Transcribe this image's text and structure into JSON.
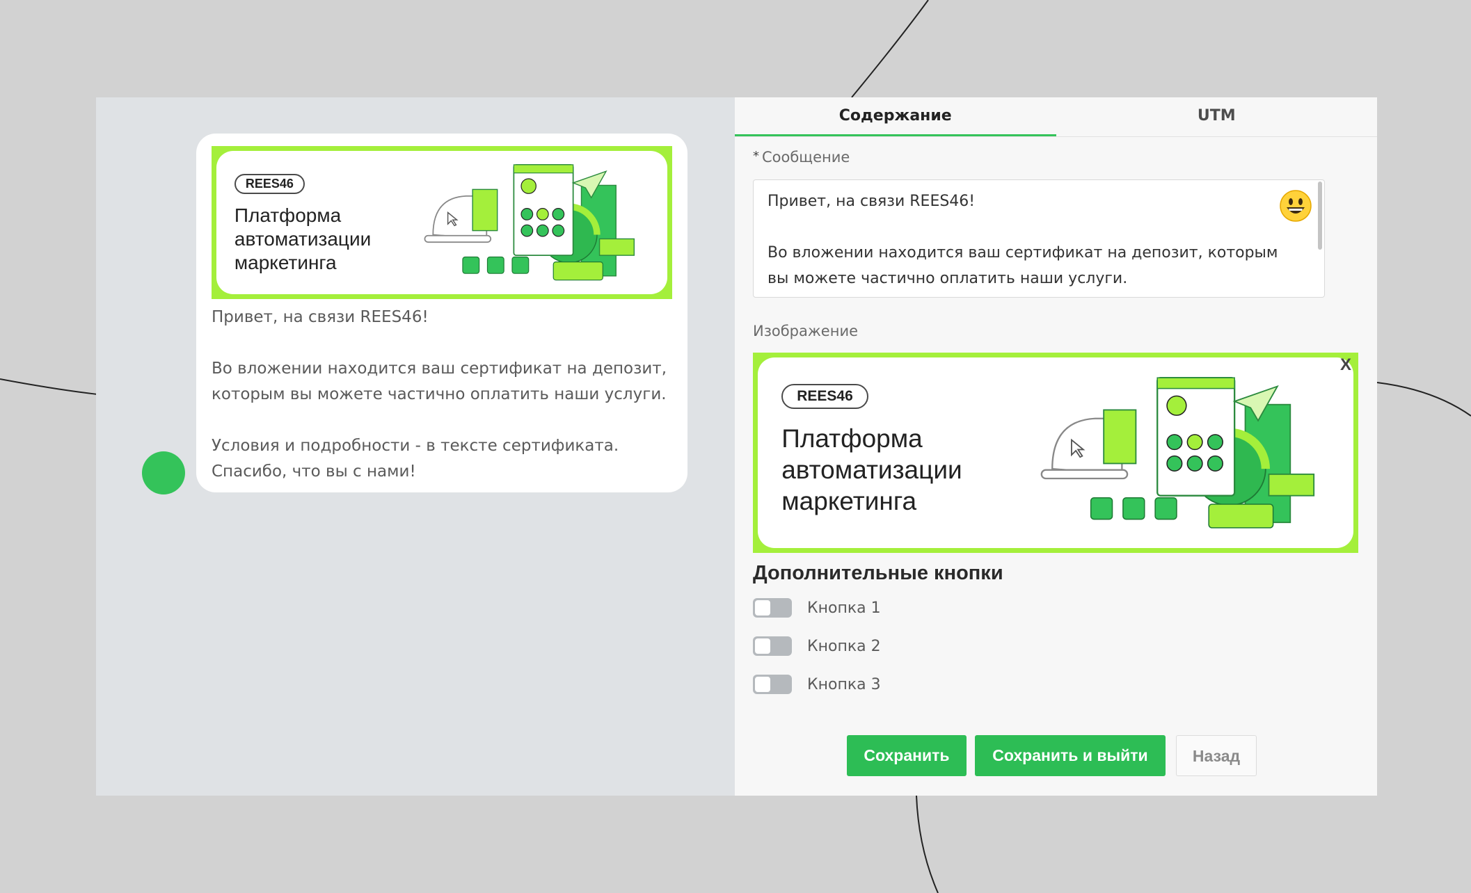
{
  "preview": {
    "banner": {
      "tag": "REES46",
      "headline": "Платформа\nавтоматизации\nмаркетинга"
    },
    "message": "Привет, на связи REES46!\n\nВо вложении находится ваш сертификат на депозит,\nкоторым вы можете частично оплатить наши услуги.\n\nУсловия и подробности - в тексте сертификата.\nСпасибо, что вы с нами!"
  },
  "tabs": [
    {
      "label": "Содержание",
      "active": true
    },
    {
      "label": "UTM",
      "active": false
    }
  ],
  "form": {
    "required_mark": "*",
    "message_label": "Сообщение",
    "message_value": "Привет, на связи REES46!\n\nВо вложении находится ваш сертификат на депозит, которым вы можете частично оплатить наши услуги.",
    "image_label": "Изображение",
    "image_close": "X",
    "banner": {
      "tag": "REES46",
      "headline": "Платформа\nавтоматизации\nмаркетинга"
    },
    "extra_buttons_title": "Дополнительные кнопки",
    "toggles": [
      {
        "label": "Кнопка 1",
        "on": false
      },
      {
        "label": "Кнопка 2",
        "on": false
      },
      {
        "label": "Кнопка 3",
        "on": false
      }
    ]
  },
  "actions": {
    "save": "Сохранить",
    "save_exit": "Сохранить и выйти",
    "back": "Назад"
  },
  "icons": {
    "emoji": "grinning-face-icon",
    "close": "close-icon"
  },
  "colors": {
    "accent": "#2dbd55",
    "banner_green": "#a4ef3b",
    "avatar_dot": "#34c35a"
  }
}
